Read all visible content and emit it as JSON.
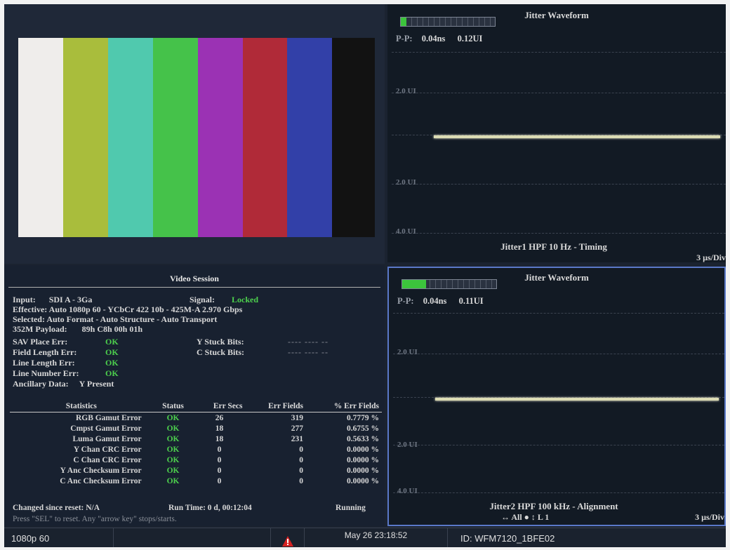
{
  "picture": {
    "bar_colors": [
      "#efedeb",
      "#a9bd3c",
      "#50c9ae",
      "#45c24a",
      "#9b32b4",
      "#b02a38",
      "#3240a8",
      "#121212"
    ]
  },
  "session": {
    "title": "Video Session",
    "input_label": "Input:",
    "input_value": "SDI A - 3Ga",
    "signal_label": "Signal:",
    "signal_value": "Locked",
    "effective_label": "Effective:",
    "effective_value": "Auto 1080p 60 - YCbCr 422 10b - 425M-A 2.970 Gbps",
    "selected_label": "Selected:",
    "selected_value": "Auto Format - Auto Structure - Auto Transport",
    "payload_label": "352M Payload:",
    "payload_value": "89h C8h 00h 01h",
    "sav_label": "SAV Place Err:",
    "sav_value": "OK",
    "field_label": "Field Length Err:",
    "field_value": "OK",
    "line_len_label": "Line Length Err:",
    "line_len_value": "OK",
    "line_num_label": "Line Number Err:",
    "line_num_value": "OK",
    "anc_label": "Ancillary Data:",
    "anc_value": "Y Present",
    "y_stuck_label": "Y Stuck Bits:",
    "y_stuck_value": "---- ---- --",
    "c_stuck_label": "C Stuck Bits:",
    "c_stuck_value": "---- ---- --",
    "stats_headers": [
      "Statistics",
      "Status",
      "Err Secs",
      "Err Fields",
      "% Err Fields"
    ],
    "stats_rows": [
      [
        "RGB Gamut Error",
        "OK",
        "26",
        "319",
        "0.7779 %"
      ],
      [
        "Cmpst Gamut Error",
        "OK",
        "18",
        "277",
        "0.6755 %"
      ],
      [
        "Luma Gamut Error",
        "OK",
        "18",
        "231",
        "0.5633 %"
      ],
      [
        "Y Chan CRC Error",
        "OK",
        "0",
        "0",
        "0.0000 %"
      ],
      [
        "C Chan CRC Error",
        "OK",
        "0",
        "0",
        "0.0000 %"
      ],
      [
        "Y Anc Checksum Error",
        "OK",
        "0",
        "0",
        "0.0000 %"
      ],
      [
        "C Anc Checksum Error",
        "OK",
        "0",
        "0",
        "0.0000 %"
      ]
    ],
    "changed_label": "Changed since reset: N/A",
    "run_time": "Run Time: 0 d, 00:12:04",
    "run_state": "Running",
    "hint": "Press \"SEL\" to reset.  Any \"arrow key\" stops/starts."
  },
  "jitter1": {
    "title": "Jitter Waveform",
    "pp_label": "P-P:",
    "pp_ns": "0.04ns",
    "pp_ui": "0.12UI",
    "meter_fill": 0.06,
    "ticks": [
      "2.0 UI",
      "",
      "2.0 UI",
      "4.0 UI"
    ],
    "footer": "Jitter1 HPF 10 Hz - Timing",
    "scale": "3 µs/Div"
  },
  "jitter2": {
    "title": "Jitter Waveform",
    "pp_label": "P-P:",
    "pp_ns": "0.04ns",
    "pp_ui": "0.11UI",
    "meter_fill": 0.25,
    "ticks": [
      "2.0 UI",
      "",
      "2.0 UI",
      "4.0 UI"
    ],
    "footer": "Jitter2 HPF 100 kHz - Alignment",
    "ctrl": "↔ All     ● ↕ L 1",
    "scale": "3 µs/Div"
  },
  "statusbar": {
    "format": "1080p 60",
    "date": "May 26 23:18:52",
    "id": "ID: WFM7120_1BFE02",
    "alarm_color": "#d42020"
  }
}
